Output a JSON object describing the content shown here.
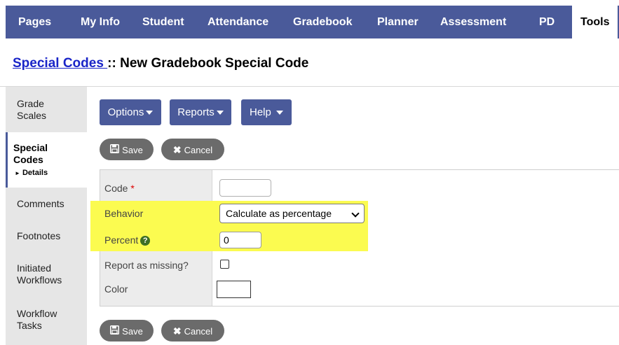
{
  "nav": {
    "items": [
      "Pages",
      "My Info",
      "Student",
      "Attendance",
      "Gradebook",
      "Planner",
      "Assessment",
      "PD",
      "Tools"
    ],
    "active": "Tools"
  },
  "title": {
    "crumb": "Special Codes ",
    "separator": ":: ",
    "text": "New Gradebook Special Code"
  },
  "sidebar": {
    "tabs": [
      {
        "label_1": "Grade",
        "label_2": "Scales"
      },
      {
        "label_1": "Special",
        "label_2": "Codes",
        "sub": "Details"
      },
      {
        "label_1": "Comments"
      },
      {
        "label_1": "Footnotes"
      },
      {
        "label_1": "Initiated",
        "label_2": "Workflows"
      },
      {
        "label_1": "Workflow",
        "label_2": "Tasks"
      }
    ]
  },
  "menus": {
    "options": "Options",
    "reports": "Reports",
    "help": "Help"
  },
  "actions": {
    "save": "Save",
    "cancel": "Cancel"
  },
  "form": {
    "code_label": "Code",
    "required_mark": "*",
    "code_value": "",
    "behavior_label": "Behavior",
    "behavior_value": "Calculate as percentage",
    "percent_label": "Percent",
    "percent_value": "0",
    "missing_label": "Report as missing?",
    "missing_checked": false,
    "color_label": "Color"
  },
  "colors": {
    "nav_bg": "#4a5a9a",
    "button_bg": "#4a5a9a",
    "pill_bg": "#6b6b6b",
    "highlight": "#fbfb50",
    "link": "#1a25c8",
    "help_icon": "#3f6f25"
  },
  "icons": {
    "save": "floppy-disk-icon",
    "cancel": "x-icon",
    "help": "question-circle-icon",
    "dropdown": "caret-down-icon",
    "sub_arrow": "triangle-right-icon"
  }
}
